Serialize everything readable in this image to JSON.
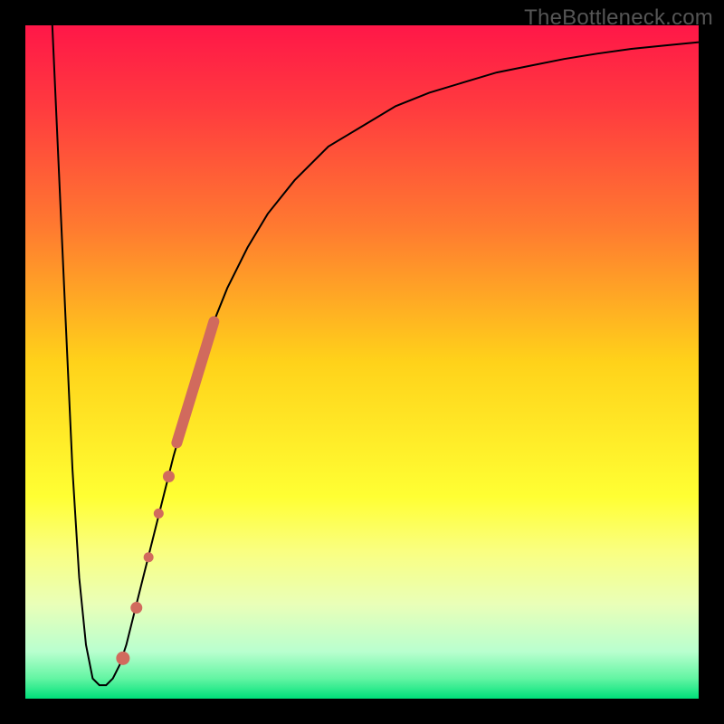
{
  "watermark": "TheBottleneck.com",
  "chart_data": {
    "type": "line",
    "title": "",
    "xlabel": "",
    "ylabel": "",
    "xlim": [
      0,
      100
    ],
    "ylim": [
      0,
      100
    ],
    "grid": false,
    "legend": false,
    "background_gradient": {
      "direction": "vertical",
      "stops": [
        {
          "pos": 0.0,
          "color": "#ff1748"
        },
        {
          "pos": 0.12,
          "color": "#ff3a3f"
        },
        {
          "pos": 0.3,
          "color": "#ff7a30"
        },
        {
          "pos": 0.5,
          "color": "#ffd21a"
        },
        {
          "pos": 0.7,
          "color": "#ffff33"
        },
        {
          "pos": 0.78,
          "color": "#faff80"
        },
        {
          "pos": 0.86,
          "color": "#e9ffb8"
        },
        {
          "pos": 0.93,
          "color": "#b9ffcf"
        },
        {
          "pos": 0.97,
          "color": "#63f5a3"
        },
        {
          "pos": 1.0,
          "color": "#00e07a"
        }
      ]
    },
    "series": [
      {
        "name": "curve",
        "color": "#000000",
        "width": 2,
        "x": [
          4,
          5,
          6,
          7,
          8,
          9,
          10,
          11,
          12,
          13,
          14,
          15,
          16,
          18,
          20,
          22,
          24,
          26,
          28,
          30,
          33,
          36,
          40,
          45,
          50,
          55,
          60,
          65,
          70,
          75,
          80,
          85,
          90,
          95,
          100
        ],
        "y": [
          100,
          78,
          56,
          34,
          18,
          8,
          3,
          2,
          2,
          3,
          5,
          8,
          12,
          20,
          28,
          36,
          43,
          50,
          56,
          61,
          67,
          72,
          77,
          82,
          85,
          88,
          90,
          91.5,
          93,
          94,
          95,
          95.8,
          96.5,
          97,
          97.5
        ]
      }
    ],
    "highlight_segments": [
      {
        "name": "band-main",
        "color": "#d16a5d",
        "width": 12,
        "x": [
          22.5,
          28.0
        ],
        "y": [
          38,
          56
        ]
      }
    ],
    "highlight_points": [
      {
        "name": "dot-1",
        "x": 21.3,
        "y": 33.0,
        "r": 6.5,
        "color": "#d16a5d"
      },
      {
        "name": "dot-2",
        "x": 19.8,
        "y": 27.5,
        "r": 5.5,
        "color": "#d16a5d"
      },
      {
        "name": "dot-3",
        "x": 18.3,
        "y": 21.0,
        "r": 5.5,
        "color": "#d16a5d"
      },
      {
        "name": "dot-4",
        "x": 16.5,
        "y": 13.5,
        "r": 6.5,
        "color": "#d16a5d"
      },
      {
        "name": "dot-5",
        "x": 14.5,
        "y": 6.0,
        "r": 7.5,
        "color": "#d16a5d"
      }
    ]
  }
}
